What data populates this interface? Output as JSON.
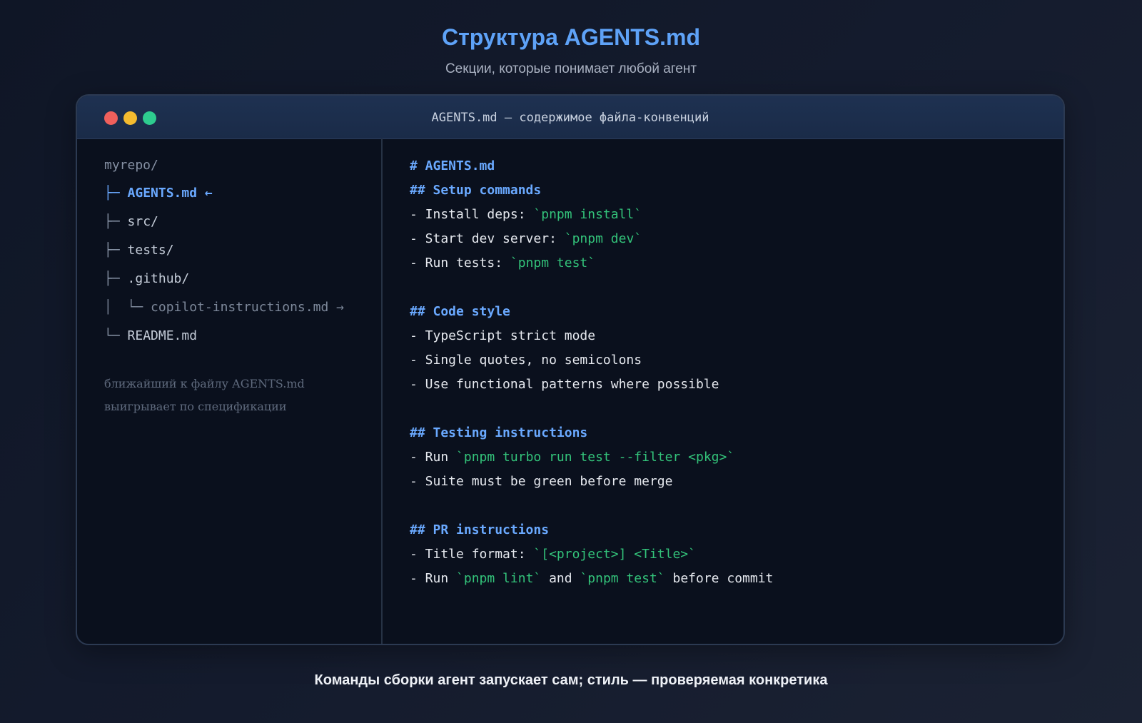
{
  "header": {
    "title": "Структура AGENTS.md",
    "subtitle": "Секции, которые понимает любой агент"
  },
  "window": {
    "title": "AGENTS.md — содержимое файла-конвенций",
    "traffic_lights": [
      "close",
      "minimize",
      "maximize"
    ],
    "colors": {
      "close": "#f0605c",
      "minimize": "#f4bb2f",
      "maximize": "#2ecc8f"
    }
  },
  "tree": {
    "root": "myrepo/",
    "items": [
      {
        "branch": "├─ ",
        "label": "AGENTS.md ←",
        "state": "active"
      },
      {
        "branch": "├─ ",
        "label": "src/",
        "state": "normal"
      },
      {
        "branch": "├─ ",
        "label": "tests/",
        "state": "normal"
      },
      {
        "branch": "├─ ",
        "label": ".github/",
        "state": "normal"
      },
      {
        "branch": "│  └─ ",
        "label": "copilot-instructions.md →",
        "state": "muted"
      },
      {
        "branch": "└─ ",
        "label": "README.md",
        "state": "normal"
      }
    ],
    "note": {
      "line1": "ближайший к файлу AGENTS.md",
      "line2": "выигрывает по спецификации"
    }
  },
  "document": {
    "title": "# AGENTS.md",
    "setup": {
      "heading": "## Setup commands",
      "l1_text": "- Install deps: ",
      "l1_code": "`pnpm install`",
      "l2_text": "- Start dev server: ",
      "l2_code": "`pnpm dev`",
      "l3_text": "- Run tests: ",
      "l3_code": "`pnpm test`"
    },
    "style": {
      "heading": "## Code style",
      "l1": "- TypeScript strict mode",
      "l2": "- Single quotes, no semicolons",
      "l3": "- Use functional patterns where possible"
    },
    "testing": {
      "heading": "## Testing instructions",
      "l1_text": "- Run ",
      "l1_code": "`pnpm turbo run test --filter <pkg>`",
      "l2": "- Suite must be green before merge"
    },
    "pr": {
      "heading": "## PR instructions",
      "l1_text": "- Title format: ",
      "l1_code": "`[<project>] <Title>`",
      "l2_text_a": "- Run ",
      "l2_code_a": "`pnpm lint`",
      "l2_text_b": " and ",
      "l2_code_b": "`pnpm test`",
      "l2_text_c": " before commit"
    }
  },
  "footer": {
    "caption": "Команды сборки агент запускает сам; стиль — проверяемая конкретика"
  },
  "colors": {
    "heading": "#6aa9ff",
    "code": "#33c37a",
    "title": "#5ea2f7"
  }
}
